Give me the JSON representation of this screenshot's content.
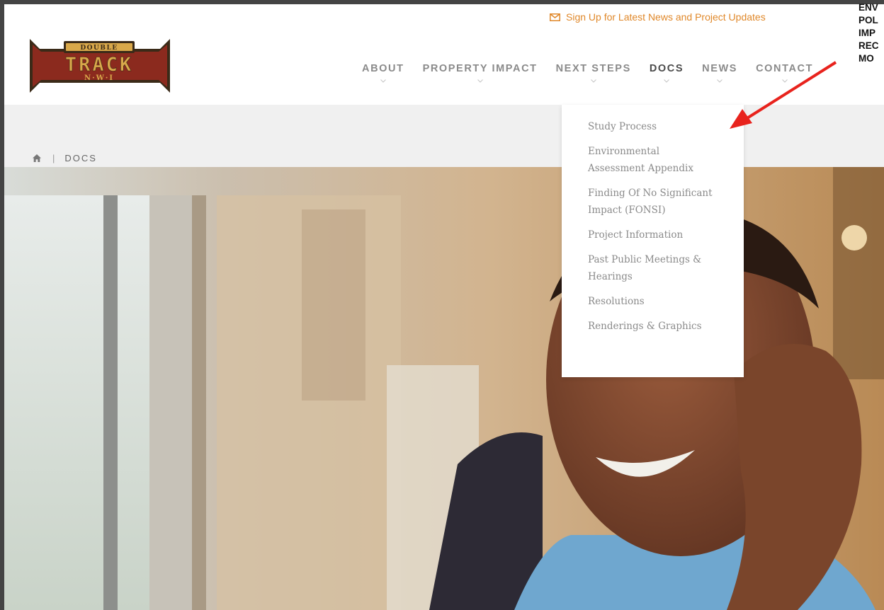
{
  "header": {
    "signup_text": "Sign Up for Latest News and Project Updates",
    "logo": {
      "top": "DOUBLE",
      "main": "TRACK",
      "bottom": "N·W·I"
    }
  },
  "nav": {
    "items": [
      {
        "label": "ABOUT"
      },
      {
        "label": "PROPERTY IMPACT"
      },
      {
        "label": "NEXT STEPS"
      },
      {
        "label": "DOCS",
        "active": true
      },
      {
        "label": "NEWS"
      },
      {
        "label": "CONTACT"
      }
    ]
  },
  "breadcrumb": {
    "current": "DOCS"
  },
  "dropdown": {
    "items": [
      "Study Process",
      "Environmental Assessment Appendix",
      "Finding Of No Significant Impact (FONSI)",
      "Project Information",
      "Past Public Meetings & Hearings",
      "Resolutions",
      "Renderings & Graphics"
    ]
  },
  "annotation": {
    "lines": [
      "ENV",
      "POL",
      "IMP",
      "REC",
      "MO"
    ]
  },
  "colors": {
    "accent_orange": "#e0882a",
    "logo_red": "#8b2a1e",
    "logo_gold": "#d9a84a",
    "annotation_arrow": "#e8231d"
  }
}
